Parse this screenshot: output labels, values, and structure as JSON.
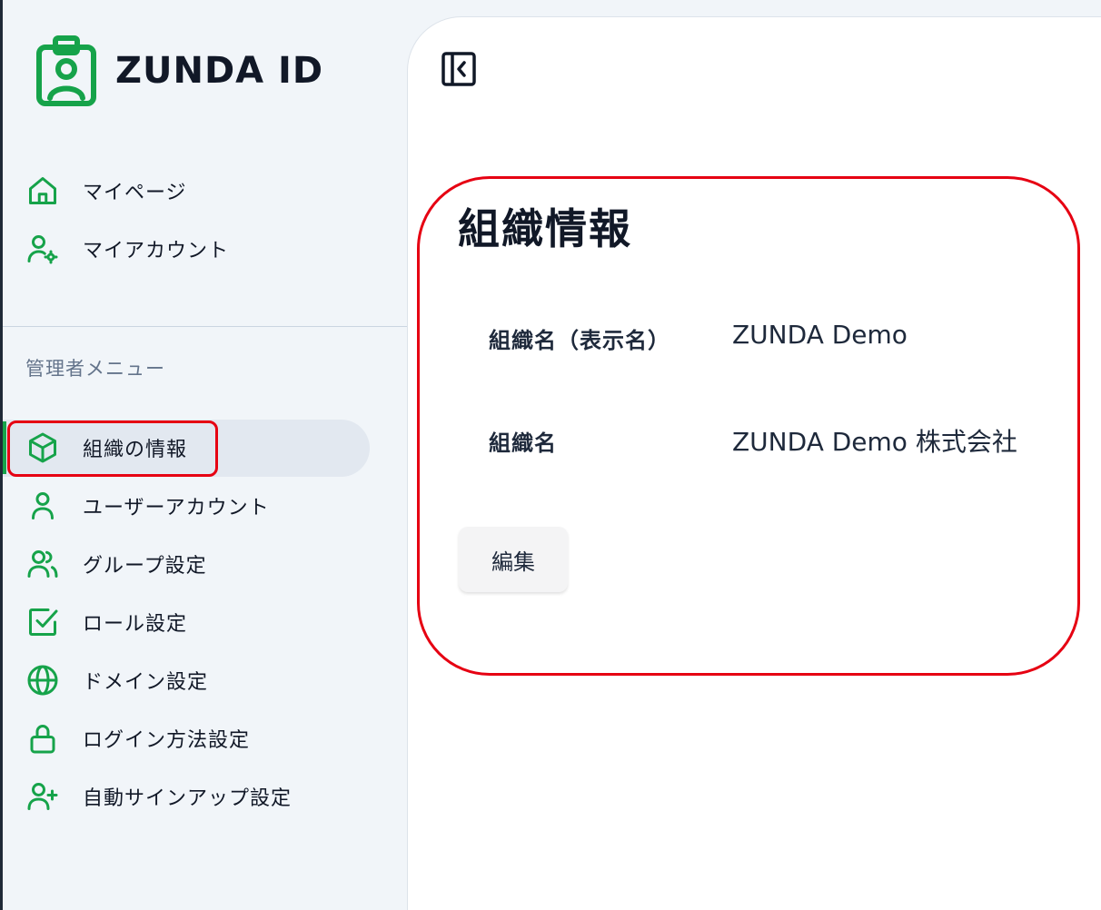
{
  "brand": {
    "logo_text": "ZUNDA ID",
    "accent_color": "#16a34a",
    "highlight_color": "#e60012"
  },
  "sidebar": {
    "user_items": [
      {
        "label": "マイページ",
        "icon": "home-icon"
      },
      {
        "label": "マイアカウント",
        "icon": "user-settings-icon"
      }
    ],
    "admin_section_label": "管理者メニュー",
    "admin_items": [
      {
        "label": "組織の情報",
        "icon": "box-icon",
        "active": true
      },
      {
        "label": "ユーザーアカウント",
        "icon": "user-icon"
      },
      {
        "label": "グループ設定",
        "icon": "users-icon"
      },
      {
        "label": "ロール設定",
        "icon": "check-square-icon"
      },
      {
        "label": "ドメイン設定",
        "icon": "globe-icon"
      },
      {
        "label": "ログイン方法設定",
        "icon": "lock-icon"
      },
      {
        "label": "自動サインアップ設定",
        "icon": "user-plus-icon"
      }
    ]
  },
  "main": {
    "title": "組織情報",
    "fields": [
      {
        "label": "組織名（表示名）",
        "value": "ZUNDA Demo"
      },
      {
        "label": "組織名",
        "value": "ZUNDA Demo 株式会社"
      }
    ],
    "edit_label": "編集"
  }
}
